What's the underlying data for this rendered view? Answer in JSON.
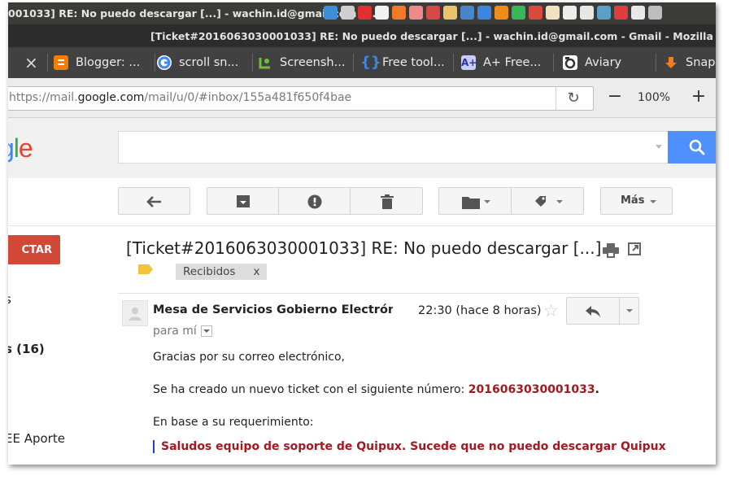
{
  "os_panel": {
    "title": "001033] RE: No puedo descargar [...] - wachin.id@gmail.com -...",
    "tray_icons": [
      {
        "name": "app-icon-1",
        "color": "#3c8fd8"
      },
      {
        "name": "app-icon-2",
        "color": "#cfcfcf"
      },
      {
        "name": "app-icon-3",
        "color": "#e23030"
      },
      {
        "name": "app-icon-4",
        "color": "#f1f1f1"
      },
      {
        "name": "app-icon-5",
        "color": "#f07a2a"
      },
      {
        "name": "app-icon-6",
        "color": "#f08a8a"
      },
      {
        "name": "app-icon-7",
        "color": "#d54848"
      },
      {
        "name": "app-icon-8",
        "color": "#e8c56a"
      },
      {
        "name": "app-icon-9",
        "color": "#4a84c9"
      },
      {
        "name": "app-icon-10",
        "color": "#3b86e0"
      },
      {
        "name": "app-icon-11",
        "color": "#f08c1c"
      },
      {
        "name": "app-icon-12",
        "color": "#35b85a"
      },
      {
        "name": "app-icon-13",
        "color": "#d94a3a"
      },
      {
        "name": "app-icon-14",
        "color": "#f3e2c2"
      },
      {
        "name": "app-icon-15",
        "color": "#ededed"
      },
      {
        "name": "app-icon-16",
        "color": "#e8e8e8"
      },
      {
        "name": "app-icon-17",
        "color": "#5aa0c8"
      },
      {
        "name": "app-icon-18",
        "color": "#e03c3c"
      },
      {
        "name": "wifi-icon",
        "color": "#e8e8e8"
      },
      {
        "name": "volume-icon",
        "color": "#bdbdbd"
      }
    ]
  },
  "window": {
    "title": "[Ticket#2016063030001033] RE: No puedo descargar [...] - wachin.id@gmail.com - Gmail - Mozilla Firefox"
  },
  "tabs": [
    {
      "label": "",
      "close": "×",
      "icon": "",
      "color": ""
    },
    {
      "label": "Blogger: ...",
      "icon": "blogger-icon",
      "color": "#f57d00"
    },
    {
      "label": "scroll sn...",
      "icon": "google-icon",
      "color": "#ffffff"
    },
    {
      "label": "Screensh...",
      "icon": "screenshot-icon",
      "color": "#6fbf3f"
    },
    {
      "label": "Free tool...",
      "icon": "brackets-icon",
      "color": "#2f6fb5"
    },
    {
      "label": "A+ Free...",
      "icon": "aplus-icon",
      "color": "#3e4aa8"
    },
    {
      "label": "Aviary",
      "icon": "aviary-icon",
      "color": "#ffffff"
    },
    {
      "label": "Snap",
      "icon": "download-icon",
      "color": "#f07c1c"
    }
  ],
  "urlbar": {
    "url_prefix": "https://mail.",
    "url_domain": "google.com",
    "url_path": "/mail/u/0/#inbox/155a481f650f4bae",
    "zoom": "100%",
    "minus": "−",
    "plus": "+"
  },
  "gmail": {
    "logo_g": "g",
    "logo_l": "l",
    "logo_e": "e",
    "toolbar": {
      "more_label": "Más"
    },
    "sidebar": {
      "compose_label": "CTAR",
      "item1": "s",
      "item2": "s (16)",
      "item3": "EE Aporte"
    },
    "message": {
      "subject": "[Ticket#2016063030001033] RE: No puedo descargar [...]",
      "label": "Recibidos",
      "label_remove": "x",
      "sender": "Mesa de Servicios Gobierno Electrónico",
      "time": "22:30 (hace 8 horas)",
      "to": "para mí",
      "greeting": "Gracias por su correo electrónico,",
      "ticket_text": "Se ha creado un nuevo ticket con el siguiente número: ",
      "ticket_number": "2016063030001033",
      "ticket_end": ".",
      "requirement": "En base a su requerimiento:",
      "quote": "Saludos equipo de soporte de Quipux. Sucede que no puedo descargar Quipux"
    }
  },
  "colors": {
    "compose": "#d14836",
    "search_button": "#4d90fe",
    "ticket_red": "#a8171d"
  }
}
